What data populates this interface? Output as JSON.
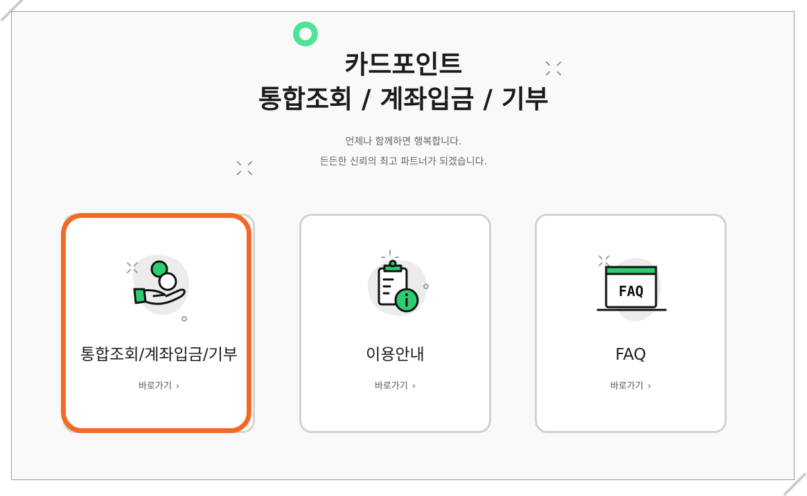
{
  "header": {
    "title_line1": "카드포인트",
    "title_line2": "통합조회 / 계좌입금 / 기부",
    "subtitle_line1": "언제나 함께하면 행복합니다.",
    "subtitle_line2": "든든한 신뢰의 최고 파트너가 되겠습니다."
  },
  "cards": [
    {
      "label": "통합조회/계좌입금/기부",
      "link": "바로가기",
      "icon": "hand-coin-icon",
      "highlighted": true
    },
    {
      "label": "이용안내",
      "link": "바로가기",
      "icon": "clipboard-info-icon",
      "highlighted": false
    },
    {
      "label": "FAQ",
      "link": "바로가기",
      "icon": "faq-monitor-icon",
      "highlighted": false,
      "icon_text": "FAQ"
    }
  ],
  "colors": {
    "accent_green": "#2ecc71",
    "highlight_orange": "#f26a26",
    "deco_ring": "#4fe495",
    "card_border": "#d2d2d2"
  }
}
